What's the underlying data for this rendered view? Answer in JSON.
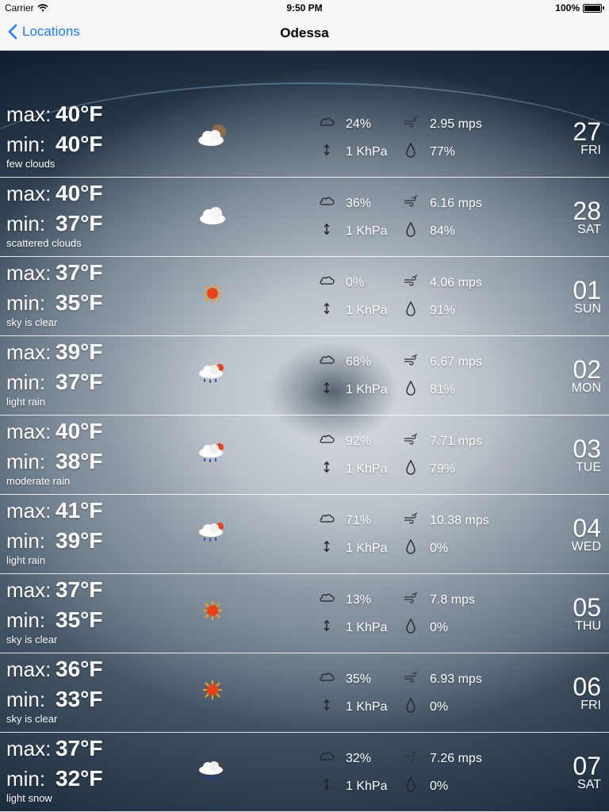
{
  "status_bar": {
    "carrier": "Carrier",
    "time": "9:50 PM",
    "battery": "100%"
  },
  "nav": {
    "back_label": "Locations",
    "title": "Odessa"
  },
  "labels": {
    "max": "max:",
    "min": "min:"
  },
  "days": [
    {
      "max": "40°F",
      "min": "40°F",
      "desc": "few clouds",
      "icon": "few-clouds-night-icon",
      "clouds": "24%",
      "wind": "2.95 mps",
      "pressure": "1 KhPa",
      "humidity": "77%",
      "day": "27",
      "dow": "FRI"
    },
    {
      "max": "40°F",
      "min": "37°F",
      "desc": "scattered clouds",
      "icon": "cloud-icon",
      "clouds": "36%",
      "wind": "6.16 mps",
      "pressure": "1 KhPa",
      "humidity": "84%",
      "day": "28",
      "dow": "SAT"
    },
    {
      "max": "37°F",
      "min": "35°F",
      "desc": "sky is clear",
      "icon": "sun-icon",
      "clouds": "0%",
      "wind": "4.06 mps",
      "pressure": "1 KhPa",
      "humidity": "91%",
      "day": "01",
      "dow": "SUN"
    },
    {
      "max": "39°F",
      "min": "37°F",
      "desc": "light rain",
      "icon": "rain-icon",
      "clouds": "68%",
      "wind": "6.67 mps",
      "pressure": "1 KhPa",
      "humidity": "81%",
      "day": "02",
      "dow": "MON"
    },
    {
      "max": "40°F",
      "min": "38°F",
      "desc": "moderate rain",
      "icon": "rain-icon",
      "clouds": "92%",
      "wind": "7.71 mps",
      "pressure": "1 KhPa",
      "humidity": "79%",
      "day": "03",
      "dow": "TUE"
    },
    {
      "max": "41°F",
      "min": "39°F",
      "desc": "light rain",
      "icon": "rain-icon",
      "clouds": "71%",
      "wind": "10.38 mps",
      "pressure": "1 KhPa",
      "humidity": "0%",
      "day": "04",
      "dow": "WED"
    },
    {
      "max": "37°F",
      "min": "35°F",
      "desc": "sky is clear",
      "icon": "sun-icon",
      "clouds": "13%",
      "wind": "7.8 mps",
      "pressure": "1 KhPa",
      "humidity": "0%",
      "day": "05",
      "dow": "THU"
    },
    {
      "max": "36°F",
      "min": "33°F",
      "desc": "sky is clear",
      "icon": "sun-icon",
      "clouds": "35%",
      "wind": "6.93 mps",
      "pressure": "1 KhPa",
      "humidity": "0%",
      "day": "06",
      "dow": "FRI"
    },
    {
      "max": "37°F",
      "min": "32°F",
      "desc": "light snow",
      "icon": "snow-icon",
      "clouds": "32%",
      "wind": "7.26 mps",
      "pressure": "1 KhPa",
      "humidity": "0%",
      "day": "07",
      "dow": "SAT"
    }
  ],
  "colors": {
    "accent": "#1a7cf4",
    "sun": "#e8401a",
    "rain": "#1d3fa0"
  }
}
